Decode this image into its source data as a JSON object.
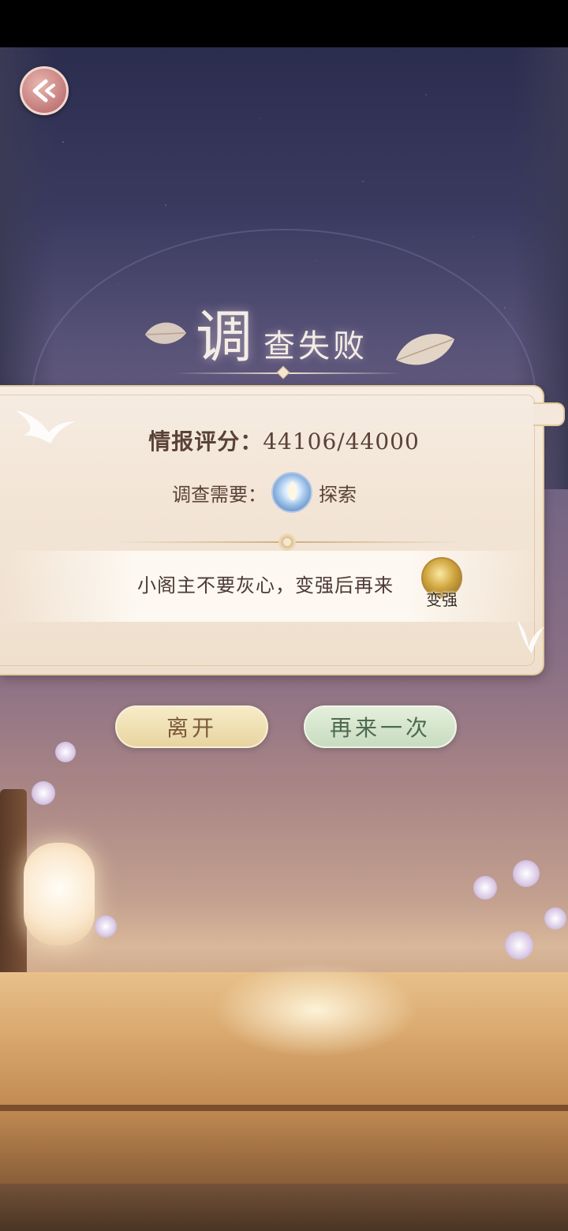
{
  "title": {
    "big_char": "调",
    "rest": "查失败"
  },
  "result": {
    "score_label": "情报评分：",
    "score_value": "44106/44000",
    "requirement_label": "调查需要：",
    "requirement_icon": "exploration-icon",
    "requirement_value": "探索"
  },
  "tip": {
    "text": "小阁主不要灰心，变强后再来",
    "strengthen_label": "变强"
  },
  "buttons": {
    "leave_label": "离开",
    "retry_label": "再来一次"
  },
  "colors": {
    "sky_top": "#2b2d4e",
    "panel_bg": "#f6ece3",
    "leave_button": "#f7ecc8",
    "retry_button": "#e4efdc",
    "back_button": "#c27a7b"
  }
}
